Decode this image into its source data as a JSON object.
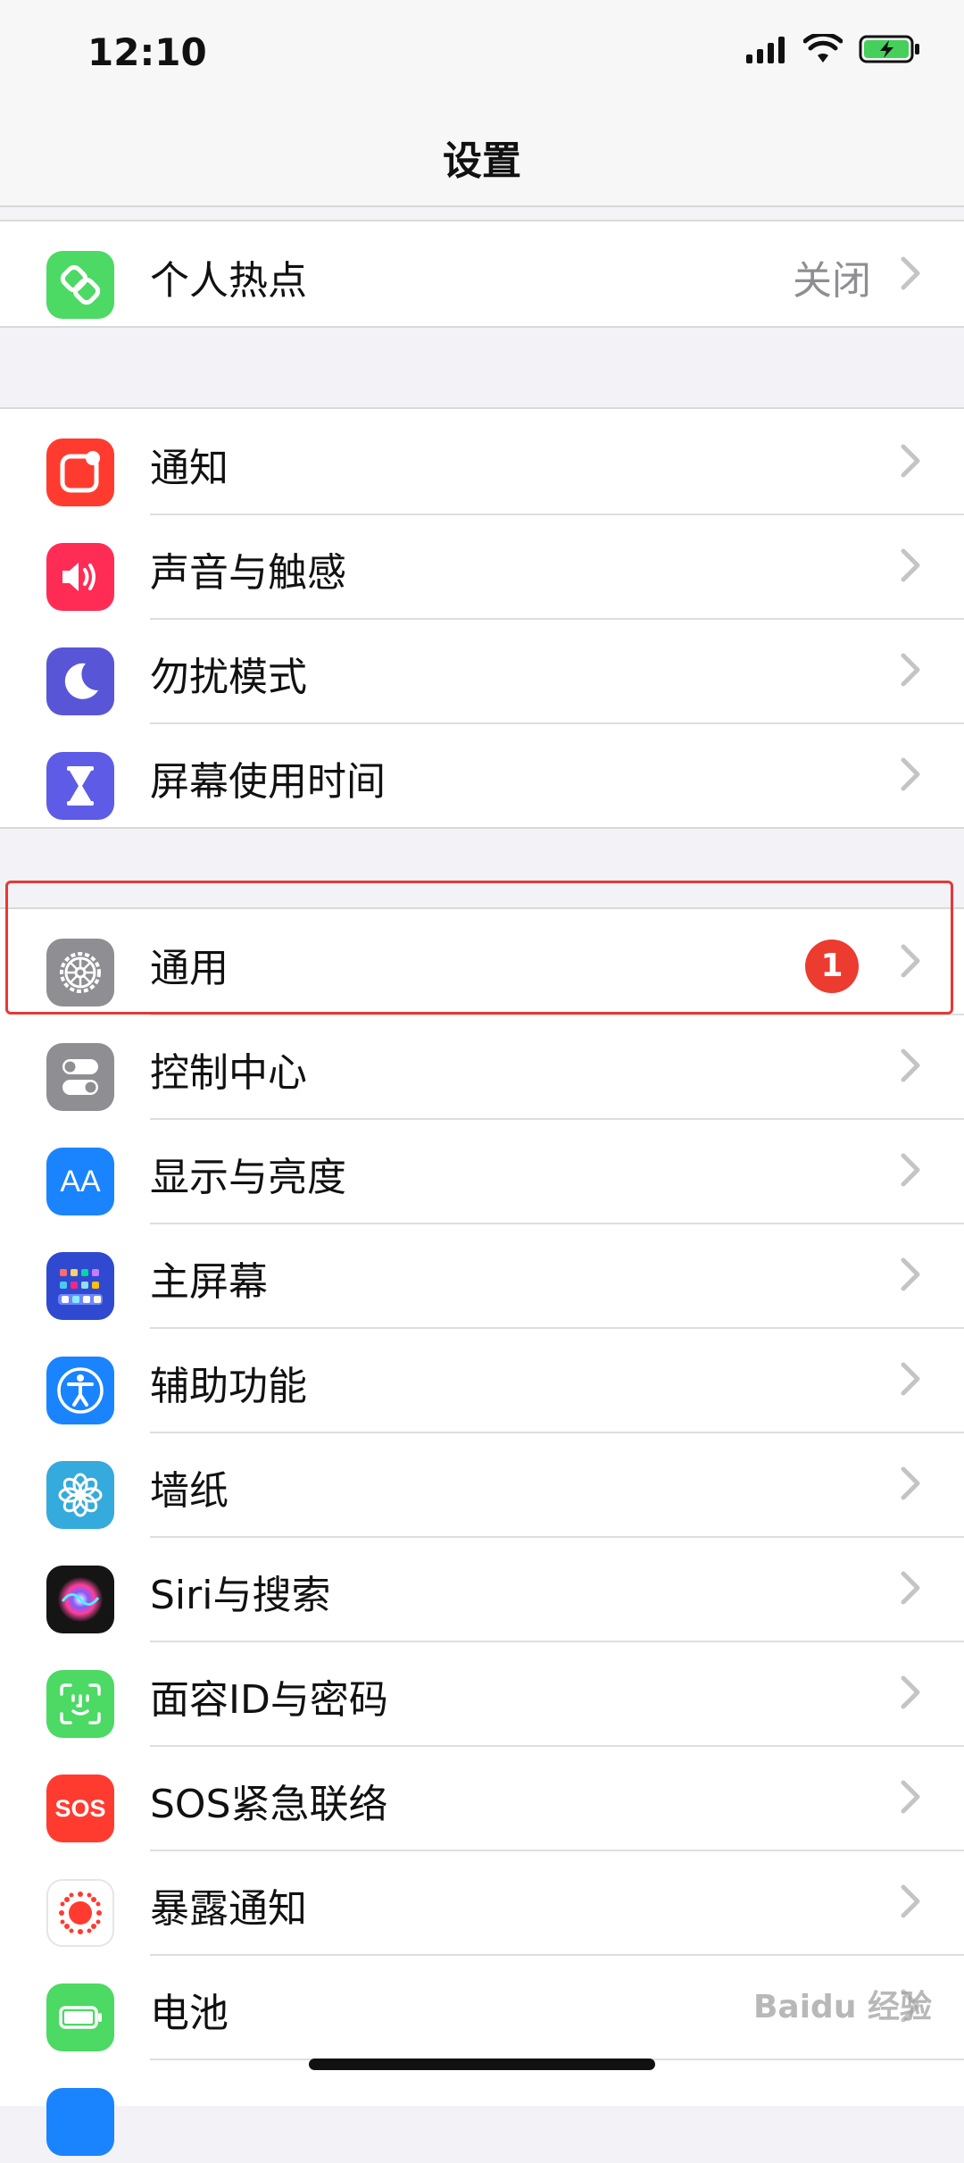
{
  "status_bar": {
    "time": "12:10",
    "signal_icon": "cellular-signal-icon",
    "wifi_icon": "wifi-icon",
    "battery_icon": "battery-charging-icon"
  },
  "nav": {
    "title": "设置"
  },
  "settings_groups": [
    {
      "items": [
        {
          "label": "个人热点",
          "value": "关闭",
          "icon": "hotspot-icon",
          "icon_color": "#4cd964"
        }
      ]
    },
    {
      "items": [
        {
          "label": "通知",
          "icon": "notifications-icon",
          "icon_color": "#ff3b30"
        },
        {
          "label": "声音与触感",
          "icon": "sound-icon",
          "icon_color": "#ff2d55"
        },
        {
          "label": "勿扰模式",
          "icon": "moon-icon",
          "icon_color": "#5856d6"
        },
        {
          "label": "屏幕使用时间",
          "icon": "hourglass-icon",
          "icon_color": "#5e5ce6"
        }
      ]
    },
    {
      "items": [
        {
          "label": "通用",
          "badge": "1",
          "icon": "gear-icon",
          "icon_color": "#8e8e93"
        },
        {
          "label": "控制中心",
          "icon": "toggles-icon",
          "icon_color": "#8e8e93"
        },
        {
          "label": "显示与亮度",
          "icon": "display-aa-icon",
          "icon_color": "#1a84ff"
        },
        {
          "label": "主屏幕",
          "icon": "home-screen-grid-icon",
          "icon_color": "#2f4ad1"
        },
        {
          "label": "辅助功能",
          "icon": "accessibility-icon",
          "icon_color": "#1a84ff"
        },
        {
          "label": "墙纸",
          "icon": "wallpaper-flower-icon",
          "icon_color": "#35aadc"
        },
        {
          "label": "Siri与搜索",
          "icon": "siri-icon",
          "icon_color": "#222222"
        },
        {
          "label": "面容ID与密码",
          "icon": "face-id-icon",
          "icon_color": "#4cd964"
        },
        {
          "label": "SOS紧急联络",
          "icon": "sos-icon",
          "icon_color": "#ff3b30"
        },
        {
          "label": "暴露通知",
          "icon": "exposure-virus-icon",
          "icon_color": "#ffffff"
        },
        {
          "label": "电池",
          "icon": "battery-icon",
          "icon_color": "#4cd964"
        }
      ]
    }
  ],
  "icons": {
    "sos_text": "SOS",
    "display_text": "AA"
  },
  "watermark": "Baidu 经验"
}
